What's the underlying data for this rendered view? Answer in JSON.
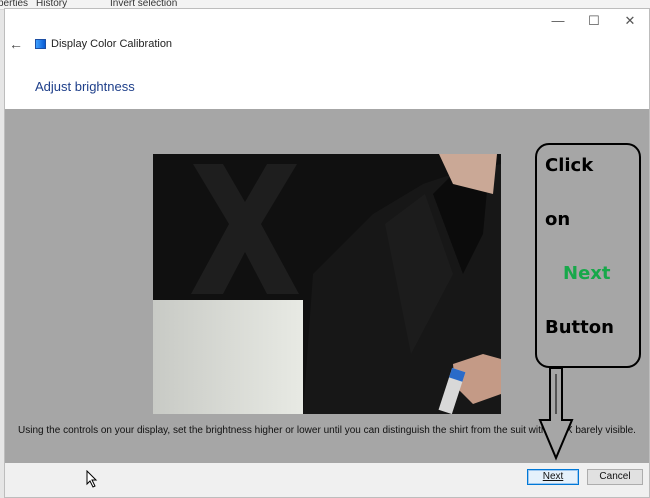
{
  "background": {
    "fragment_1": "perties",
    "fragment_2": "History",
    "fragment_3": "Invert selection"
  },
  "window": {
    "title": "Display Color Calibration",
    "heading": "Adjust brightness",
    "controls": {
      "minimize": "—",
      "maximize": "☐",
      "close": "✕"
    }
  },
  "content": {
    "instructions": "Using the controls on your display, set the brightness higher or lower until you can distinguish the shirt from the suit with the X barely visible."
  },
  "footer": {
    "next_label": "Next",
    "cancel_label": "Cancel"
  },
  "annotation": {
    "line1": "Click",
    "line2": "on",
    "line3": "Next",
    "line4": "Button",
    "accent_color": "#17a84a"
  }
}
